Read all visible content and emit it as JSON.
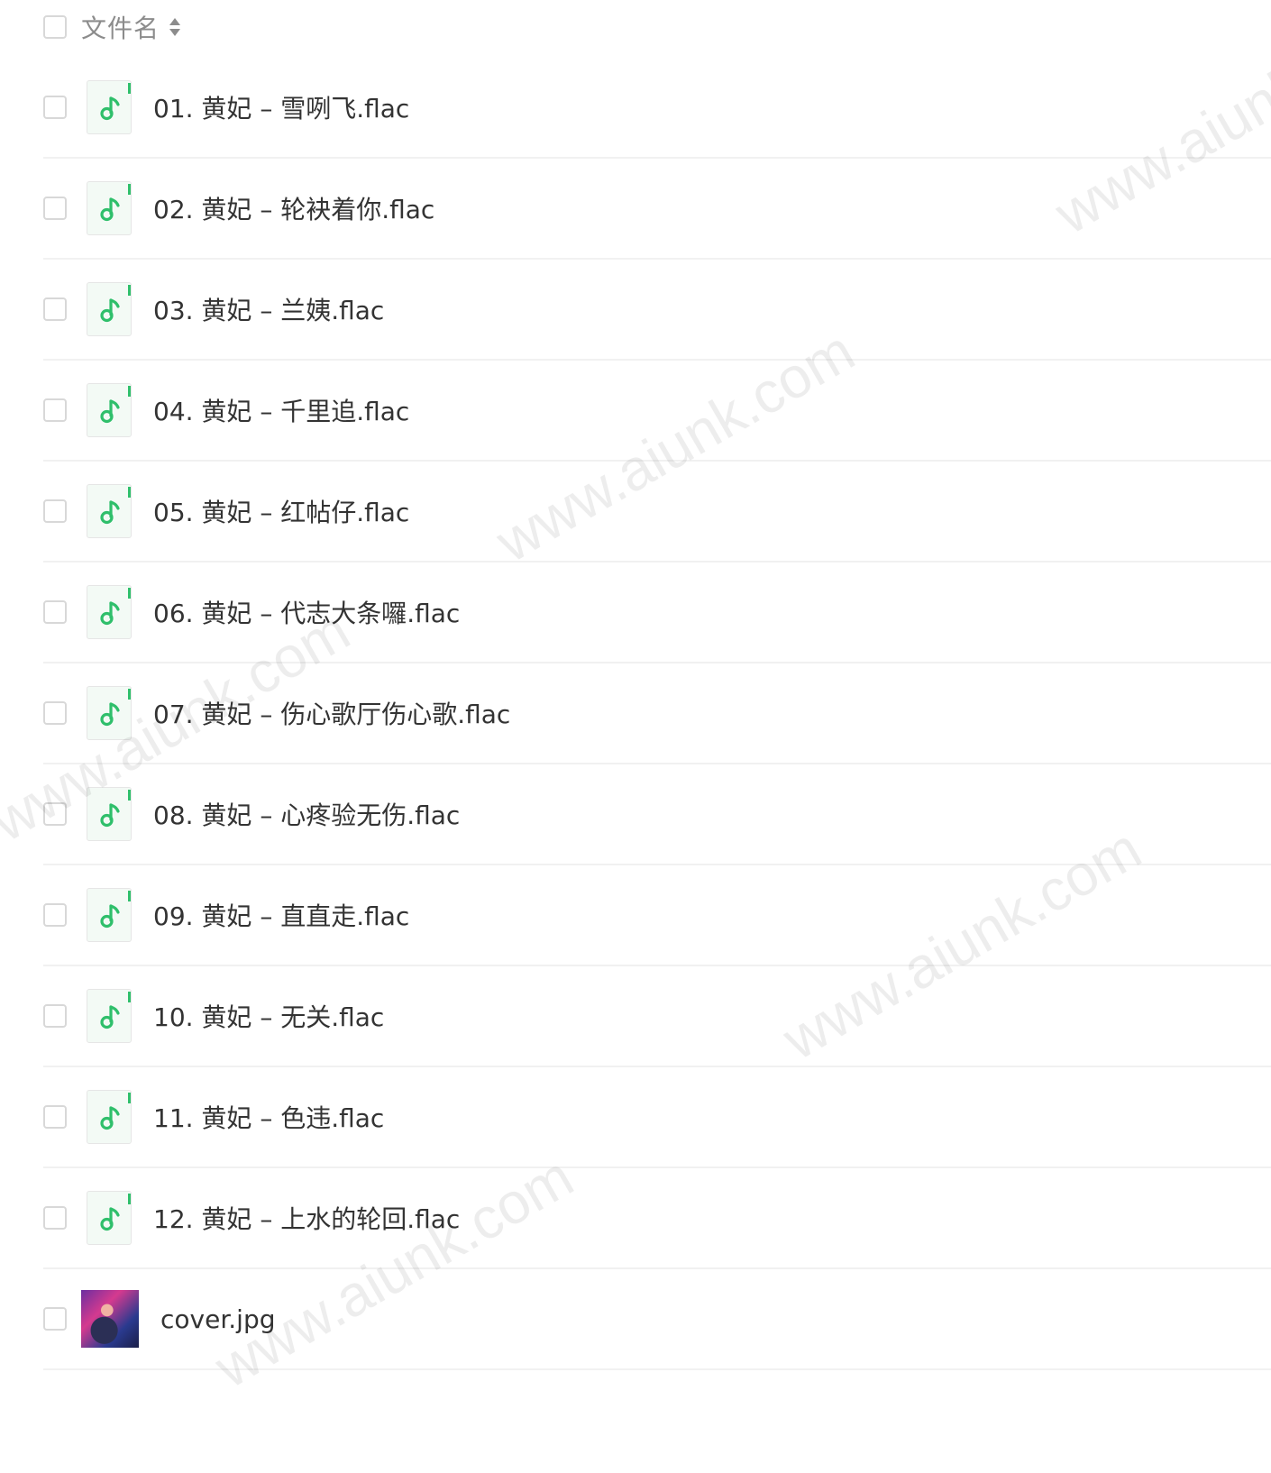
{
  "header": {
    "label": "文件名"
  },
  "files": [
    {
      "name": "01. 黄妃 – 雪咧飞.flac",
      "type": "audio"
    },
    {
      "name": "02. 黄妃 – 轮袂着你.flac",
      "type": "audio"
    },
    {
      "name": "03. 黄妃 – 兰姨.flac",
      "type": "audio"
    },
    {
      "name": "04. 黄妃 – 千里追.flac",
      "type": "audio"
    },
    {
      "name": "05. 黄妃 – 红帖仔.flac",
      "type": "audio"
    },
    {
      "name": "06. 黄妃 – 代志大条囉.flac",
      "type": "audio"
    },
    {
      "name": "07. 黄妃 – 伤心歌厅伤心歌.flac",
      "type": "audio"
    },
    {
      "name": "08. 黄妃 – 心疼验无伤.flac",
      "type": "audio"
    },
    {
      "name": "09. 黄妃 – 直直走.flac",
      "type": "audio"
    },
    {
      "name": "10. 黄妃 – 无关.flac",
      "type": "audio"
    },
    {
      "name": "11. 黄妃 – 色违.flac",
      "type": "audio"
    },
    {
      "name": "12. 黄妃 – 上水的轮回.flac",
      "type": "audio"
    },
    {
      "name": "cover.jpg",
      "type": "image"
    }
  ],
  "watermark": "www.aiunk.com",
  "colors": {
    "accent": "#2fbf6b",
    "row_divider": "#f1f1f1",
    "checkbox_border": "#d8d8d8",
    "header_text": "#8c8c8c",
    "text": "#333333"
  },
  "icons": {
    "sort": "sort-icon",
    "audio": "music-note-icon",
    "image": "image-thumbnail"
  }
}
